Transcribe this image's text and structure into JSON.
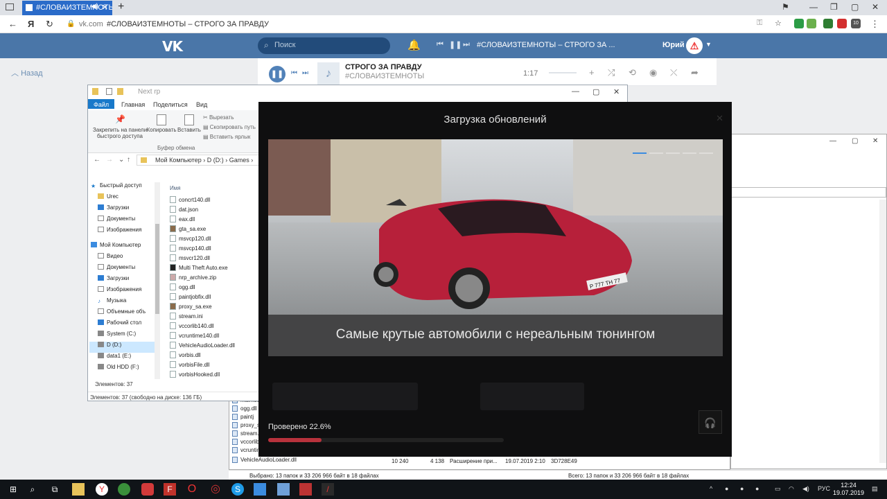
{
  "browser": {
    "tab_title": "#СЛОВАИЗТЕМНОТЫ",
    "domain": "vk.com",
    "url_title": "#СЛОВАИЗТЕМНОТЫ – СТРОГО ЗА ПРАВДУ",
    "new_tab": "+",
    "ya_label": "Я",
    "ext_badge": "10"
  },
  "vk": {
    "logo": "VK",
    "search_placeholder": "Поиск",
    "header_track": "#СЛОВАИЗТЕМНОТЫ – СТРОГО ЗА ...",
    "user_name": "Юрий",
    "back_label": "Назад"
  },
  "player": {
    "title": "СТРОГО ЗА ПРАВДУ",
    "artist": "#СЛОВАИЗТЕМНОТЫ",
    "time": "1:17"
  },
  "explorer": {
    "window_title": "Next rp",
    "ribbon_tabs": [
      "Файл",
      "Главная",
      "Поделиться",
      "Вид"
    ],
    "ribbon_buttons": {
      "pin": "Закрепить на панели быстрого доступа",
      "copy": "Копировать",
      "paste": "Вставить",
      "cut": "Вырезать",
      "copy_path": "Скопировать путь",
      "paste_shortcut": "Вставить ярлык",
      "group": "Буфер обмена"
    },
    "path": "Мой Компьютер  ›  D (D:)  ›  Games  ›",
    "column_name": "Имя",
    "nav_items": [
      "Быстрый доступ",
      "Urec",
      "Загрузки",
      "Документы",
      "Изображения",
      "Мой Компьютер",
      "Видео",
      "Документы",
      "Загрузки",
      "Изображения",
      "Музыка",
      "Объемные объ",
      "Рабочий стол",
      "System (C:)",
      "D (D:)",
      "data1 (E:)",
      "Old HDD (F:)"
    ],
    "files": [
      "concrt140.dll",
      "dat.json",
      "eax.dll",
      "gta_sa.exe",
      "msvcp120.dll",
      "msvcp140.dll",
      "msvcr120.dll",
      "Multi Theft Auto.exe",
      "nrp_archive.zip",
      "ogg.dll",
      "paintjobfix.dll",
      "proxy_sa.exe",
      "stream.ini",
      "vccorlib140.dll",
      "vcruntime140.dll",
      "VehicleAudioLoader.dll",
      "vorbis.dll",
      "vorbisFile.dll",
      "vorbisHooked.dll"
    ],
    "item_count": "Элементов: 37",
    "status": "Элементов: 37 (свободно на диске: 136 ГБ)"
  },
  "lower_window": {
    "files": [
      "main.scm",
      "ogg.dll",
      "paintj",
      "proxy_s",
      "stream.",
      "vccorlib",
      "vcruntin",
      "VehicleAudioLoader.dll"
    ],
    "row_size": "10 240",
    "row_size2": "4 138",
    "row_type": "Расширение при...",
    "row_date": "19.07.2019 2:10",
    "row_crc": "3D728E49",
    "status_left": "Выбрано: 13 папок и 33 206 966 байт в 18 файлах",
    "status_right": "Всего: 13 папок и 33 206 966 байт в 18 файлах"
  },
  "launcher": {
    "title": "Загрузка обновлений",
    "caption": "Самые крутые автомобили с нереальным тюнингом",
    "plate": "Р 777 ТН 77",
    "progress_label": "Проверено 22.6%",
    "progress": 0.226
  },
  "taskbar": {
    "language": "РУС",
    "time": "12:24",
    "date": "19.07.2019"
  },
  "colors": {
    "vk_blue": "#4a76a8",
    "progress_red": "#b8323c",
    "tab_blue": "#2a6bc9"
  }
}
